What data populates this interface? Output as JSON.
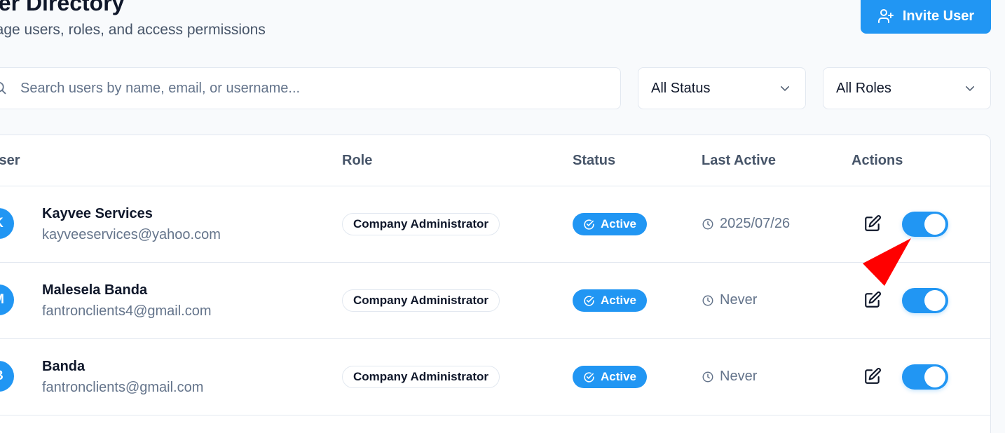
{
  "header": {
    "title": "ser Directory",
    "subtitle": "nage users, roles, and access permissions",
    "invite_label": "Invite User"
  },
  "filters": {
    "search_placeholder": "Search users by name, email, or username...",
    "status_value": "All Status",
    "roles_value": "All Roles"
  },
  "table": {
    "columns": {
      "user": "User",
      "role": "Role",
      "status": "Status",
      "last_active": "Last Active",
      "actions": "Actions"
    },
    "rows": [
      {
        "initial": "K",
        "name": "Kayvee Services",
        "email": "kayveeservices@yahoo.com",
        "role": "Company Administrator",
        "status": "Active",
        "last_active": "2025/07/26",
        "enabled": true
      },
      {
        "initial": "M",
        "name": "Malesela Banda",
        "email": "fantronclients4@gmail.com",
        "role": "Company Administrator",
        "status": "Active",
        "last_active": "Never",
        "enabled": true
      },
      {
        "initial": "B",
        "name": "Banda",
        "email": "fantronclients@gmail.com",
        "role": "Company Administrator",
        "status": "Active",
        "last_active": "Never",
        "enabled": true
      }
    ]
  },
  "colors": {
    "accent": "#2196f3",
    "cursor_arrow": "#ff0000"
  }
}
